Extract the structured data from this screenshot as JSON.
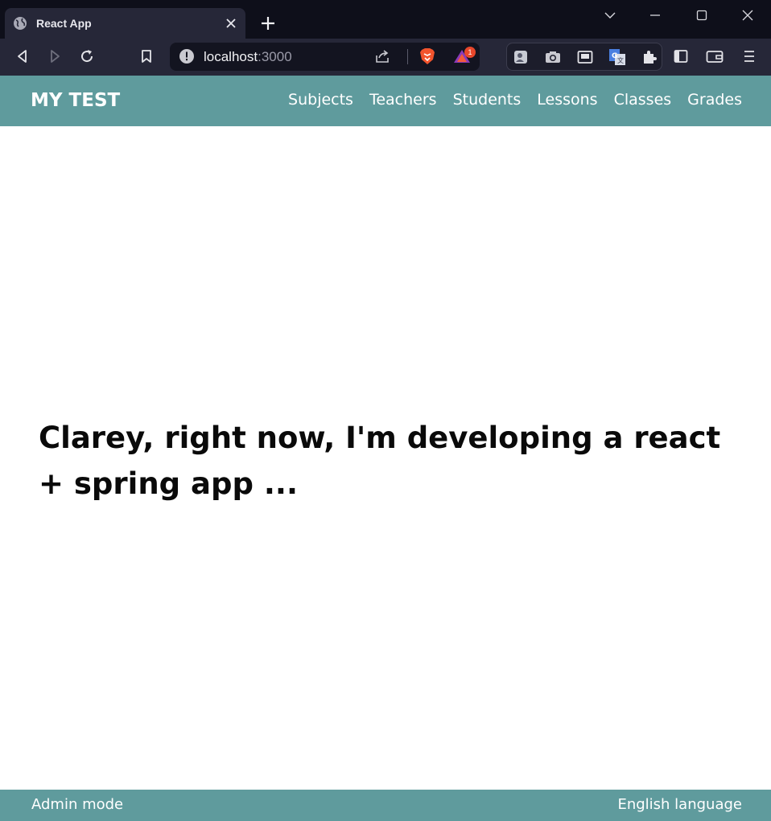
{
  "browser": {
    "tab_title": "React App",
    "url_host": "localhost",
    "url_port": ":3000",
    "brave_rewards_badge": "1",
    "icons": {
      "favicon": "globe-icon",
      "tab_close": "close-icon",
      "new_tab": "plus-icon",
      "tab_search": "chevron-down-icon",
      "minimize": "minimize-icon",
      "maximize": "maximize-icon",
      "close_window": "close-icon",
      "back": "back-arrow-icon",
      "forward": "forward-arrow-icon",
      "reload": "reload-icon",
      "bookmark": "bookmark-icon",
      "site_info": "info-icon",
      "share": "share-icon",
      "brave_shields": "brave-lion-icon",
      "brave_rewards": "triangle-rewards-icon",
      "extensions": [
        "contact-card-icon",
        "camera-icon",
        "picture-in-picture-icon",
        "translate-icon",
        "puzzle-icon"
      ],
      "sidebar": "sidebar-icon",
      "wallet": "wallet-icon",
      "menu": "hamburger-menu-icon"
    }
  },
  "page": {
    "brand": "MY TEST",
    "nav": [
      "Subjects",
      "Teachers",
      "Students",
      "Lessons",
      "Classes",
      "Grades"
    ],
    "headline": "Clarey, right now, I'm developing a react + spring app ...",
    "footer": {
      "left": "Admin mode",
      "right": "English language"
    }
  },
  "colors": {
    "accent": "#5f9b9d",
    "chrome_dark": "#0e0f1a",
    "toolbar": "#262738",
    "text": "#0a0a0a"
  }
}
